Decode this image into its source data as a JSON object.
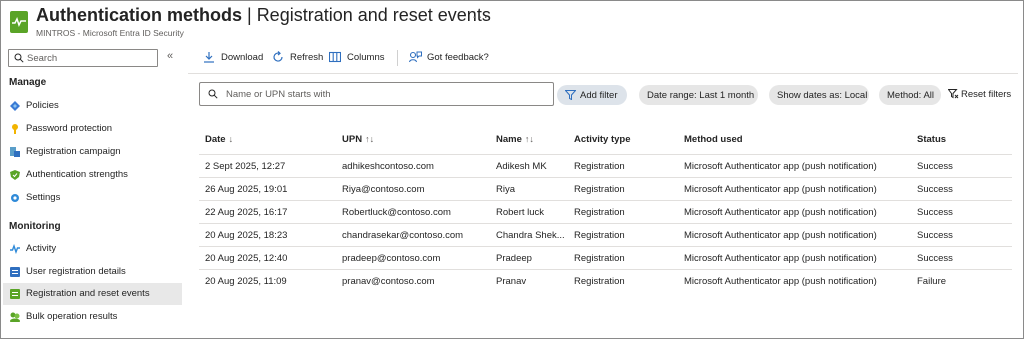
{
  "header": {
    "title_main": "Authentication methods",
    "title_sep": " | ",
    "title_page": "Registration and reset events",
    "more": "···",
    "subtitle": "MINTROS - Microsoft Entra ID Security"
  },
  "sidebar": {
    "search_placeholder": "Search",
    "collapse": "«",
    "sections": [
      {
        "label": "Manage",
        "items": [
          {
            "label": "Policies",
            "icon": "policies-icon",
            "color": "#3a7bd5"
          },
          {
            "label": "Password protection",
            "icon": "key-icon",
            "color": "#f2b400"
          },
          {
            "label": "Registration campaign",
            "icon": "campaign-icon",
            "color": "#5a9ec9"
          },
          {
            "label": "Authentication strengths",
            "icon": "shield-icon",
            "color": "#5aa427"
          },
          {
            "label": "Settings",
            "icon": "gear-icon",
            "color": "#2f8ad8"
          }
        ]
      },
      {
        "label": "Monitoring",
        "items": [
          {
            "label": "Activity",
            "icon": "activity-icon",
            "color": "#2f8ad8"
          },
          {
            "label": "User registration details",
            "icon": "user-details-icon",
            "color": "#2f6fbf"
          },
          {
            "label": "Registration and reset events",
            "icon": "events-icon",
            "color": "#5aa427",
            "active": true
          },
          {
            "label": "Bulk operation results",
            "icon": "bulk-icon",
            "color": "#5aa427"
          }
        ]
      }
    ]
  },
  "toolbar": {
    "download": "Download",
    "refresh": "Refresh",
    "columns": "Columns",
    "feedback": "Got feedback?"
  },
  "filters": {
    "search_placeholder": "Name or UPN starts with",
    "add_filter": "Add filter",
    "date_range": "Date range: Last 1 month",
    "show_dates": "Show dates as: Local",
    "method": "Method: All",
    "reset": "Reset filters"
  },
  "table": {
    "columns": [
      "Date",
      "UPN",
      "Name",
      "Activity type",
      "Method used",
      "Status"
    ],
    "sort_date": "↓",
    "sort_upn": "↑↓",
    "sort_name": "↑↓",
    "rows": [
      [
        "2 Sept 2025, 12:27",
        "adhikeshcontoso.com",
        "Adikesh MK",
        "Registration",
        "Microsoft Authenticator app (push notification)",
        "Success"
      ],
      [
        "26 Aug 2025, 19:01",
        "Riya@contoso.com",
        "Riya",
        "Registration",
        "Microsoft Authenticator app (push notification)",
        "Success"
      ],
      [
        "22 Aug 2025, 16:17",
        "Robertluck@contoso.com",
        "Robert luck",
        "Registration",
        "Microsoft Authenticator app (push notification)",
        "Success"
      ],
      [
        "20 Aug 2025, 18:23",
        "chandrasekar@contoso.com",
        "Chandra Shek...",
        "Registration",
        "Microsoft Authenticator app (push notification)",
        "Success"
      ],
      [
        "20 Aug 2025, 12:40",
        "pradeep@contoso.com",
        "Pradeep",
        "Registration",
        "Microsoft Authenticator app (push notification)",
        "Success"
      ],
      [
        "20 Aug 2025, 11:09",
        "pranav@contoso.com",
        "Pranav",
        "Registration",
        "Microsoft Authenticator app (push notification)",
        "Failure"
      ]
    ]
  }
}
